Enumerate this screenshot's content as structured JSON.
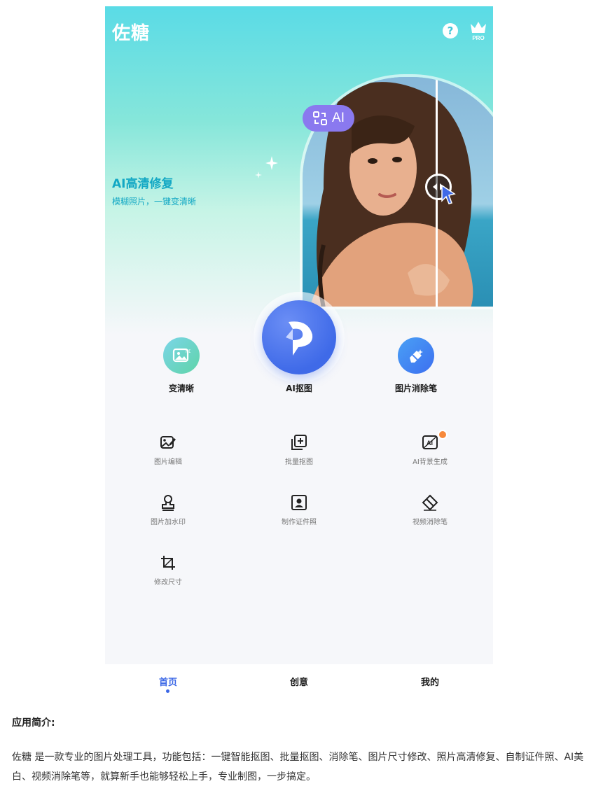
{
  "app": {
    "title": "佐糖",
    "help_glyph": "?",
    "pro_label": "PRO"
  },
  "hero": {
    "feature_title": "AI高清修复",
    "feature_subtitle": "模糊照片，一键变清晰",
    "badge_label": "AI"
  },
  "main_actions": [
    {
      "label": "变清晰",
      "icon": "image-enhance-icon"
    },
    {
      "label": "AI抠图",
      "icon": "ai-cutout-logo-icon"
    },
    {
      "label": "图片消除笔",
      "icon": "eraser-icon"
    }
  ],
  "tools": [
    {
      "label": "图片编辑",
      "icon": "image-edit-icon"
    },
    {
      "label": "批量抠图",
      "icon": "batch-cutout-icon"
    },
    {
      "label": "AI背景生成",
      "icon": "ai-background-icon",
      "hot": true
    },
    {
      "label": "图片加水印",
      "icon": "watermark-stamp-icon"
    },
    {
      "label": "制作证件照",
      "icon": "id-photo-icon"
    },
    {
      "label": "视频消除笔",
      "icon": "video-eraser-icon"
    },
    {
      "label": "修改尺寸",
      "icon": "crop-resize-icon"
    }
  ],
  "bottom_nav": [
    {
      "label": "首页",
      "active": true
    },
    {
      "label": "创意",
      "active": false
    },
    {
      "label": "我的",
      "active": false
    }
  ],
  "intro": {
    "title": "应用简介:",
    "body": "佐糖 是一款专业的图片处理工具，功能包括：一键智能抠图、批量抠图、消除笔、图片尺寸修改、照片高清修复、自制证件照、AI美白、视频消除笔等，就算新手也能够轻松上手，专业制图，一步搞定。"
  },
  "colors": {
    "accent_blue": "#3b67e6",
    "hero_teal": "#13a8c4",
    "ai_badge_purple": "#8a79ef",
    "hot_badge_orange": "#f7893b"
  }
}
